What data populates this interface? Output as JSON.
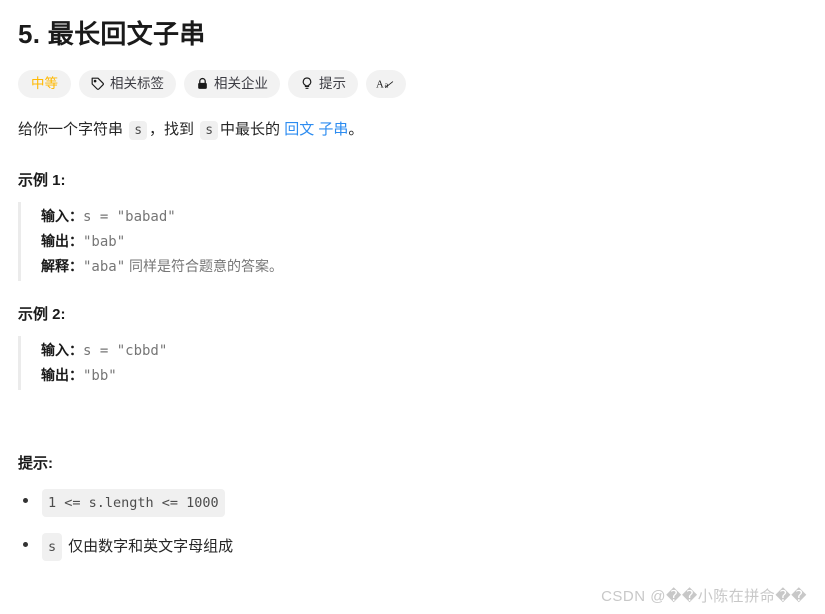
{
  "problem": {
    "title": "5. 最长回文子串",
    "description": {
      "pre": "给你一个字符串",
      "code1": "s",
      "mid1": "，找到",
      "code2": "s",
      "mid2": "中最长的",
      "link1": "回文",
      "link2": "子串",
      "suffix": "。"
    }
  },
  "badges": [
    {
      "id": "difficulty",
      "label": "中等",
      "icon": "none",
      "color": "#ffb800"
    },
    {
      "id": "related-tags",
      "label": "相关标签",
      "icon": "tag-icon"
    },
    {
      "id": "related-companies",
      "label": "相关企业",
      "icon": "lock-icon"
    },
    {
      "id": "hint",
      "label": "提示",
      "icon": "lightbulb-icon"
    },
    {
      "id": "font-size",
      "label": "Aa",
      "icon": "font-size-icon"
    }
  ],
  "examples": [
    {
      "heading": "示例 1:",
      "lines": [
        {
          "label": "输入：",
          "value": "s = \"babad\"",
          "type": "code"
        },
        {
          "label": "输出：",
          "value": "\"bab\"",
          "type": "code"
        },
        {
          "label": "解释：",
          "value": "\"aba\"",
          "note": " 同样是符合题意的答案。",
          "type": "code"
        }
      ]
    },
    {
      "heading": "示例 2:",
      "lines": [
        {
          "label": "输入：",
          "value": "s = \"cbbd\"",
          "type": "code"
        },
        {
          "label": "输出：",
          "value": "\"bb\"",
          "type": "code"
        }
      ]
    }
  ],
  "constraints": {
    "heading": "提示:",
    "items": [
      {
        "code": "1 <= s.length <= 1000",
        "text": ""
      },
      {
        "code": "s",
        "text": "仅由数字和英文字母组成"
      }
    ]
  },
  "watermark": "CSDN @��小陈在拼命��"
}
